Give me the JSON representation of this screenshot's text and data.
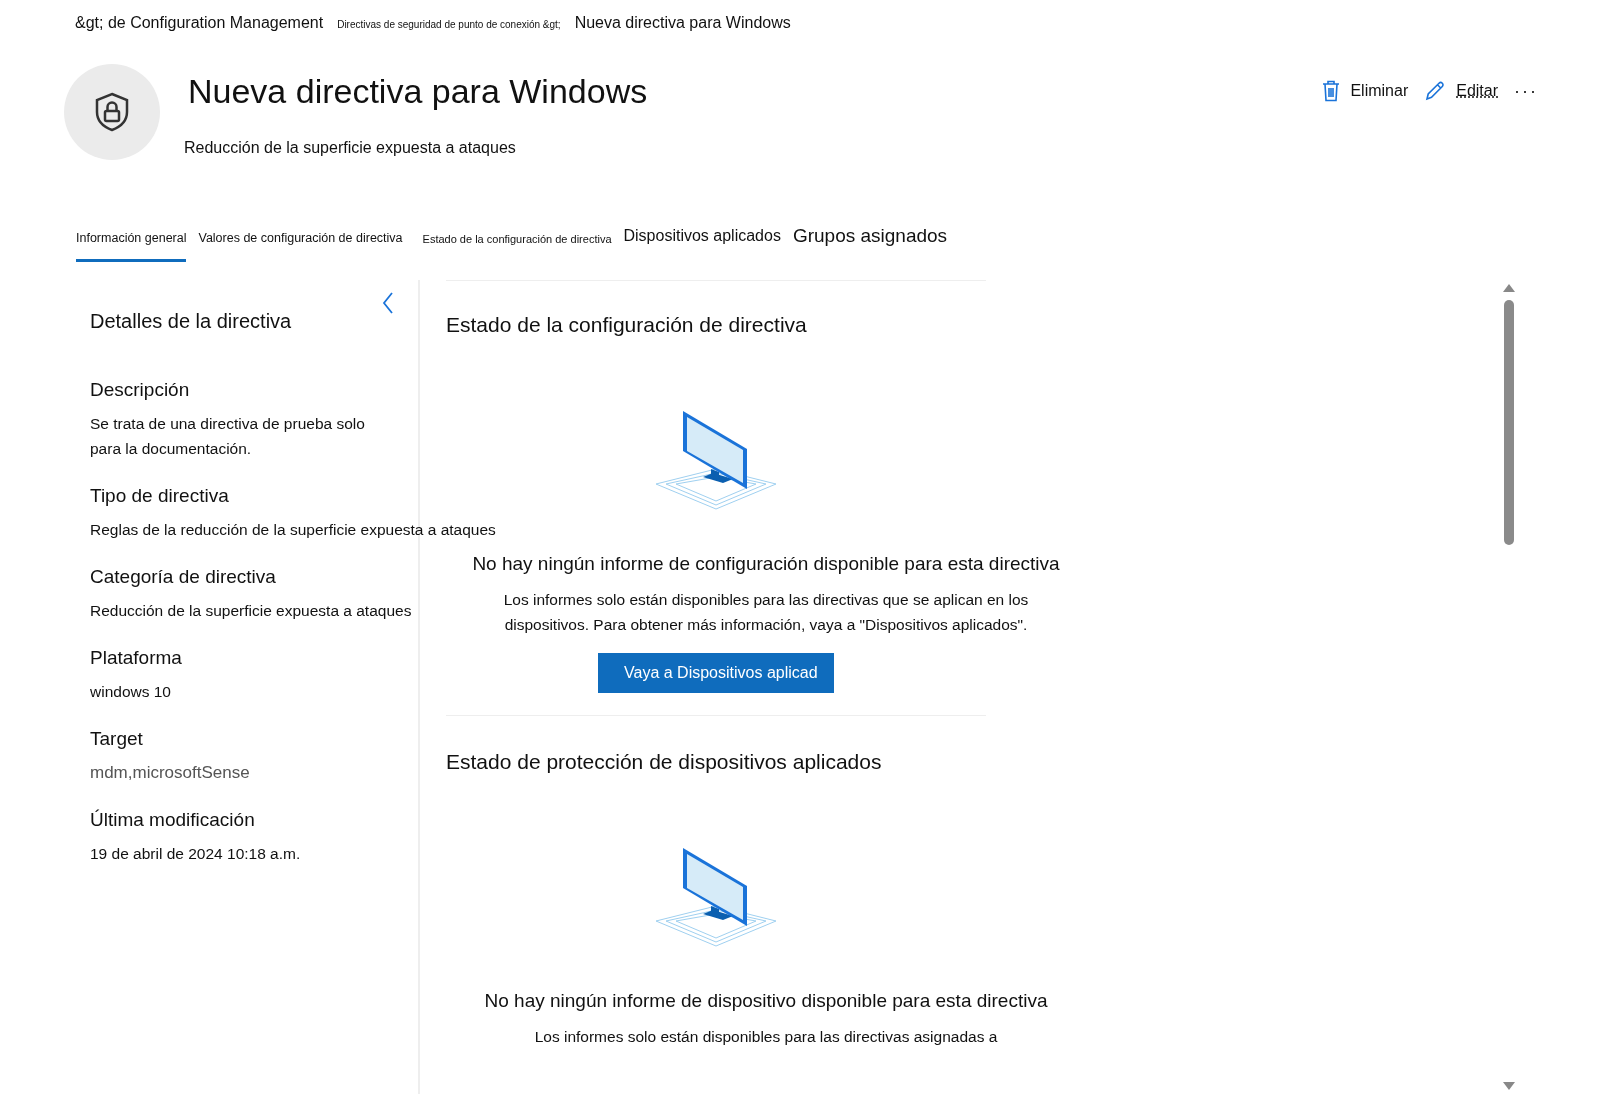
{
  "breadcrumb": [
    "&gt; de Configuration Management",
    "Directivas de seguridad de punto de conexión &gt;",
    "Nueva directiva para Windows"
  ],
  "header": {
    "title": "Nueva directiva para Windows",
    "subtitle": "Reducción de la superficie expuesta a ataques"
  },
  "actions": [
    {
      "kind": "delete",
      "label": "Eliminar"
    },
    {
      "kind": "edit",
      "label": "Editar"
    },
    {
      "kind": "more",
      "label": "···"
    }
  ],
  "tabs": [
    {
      "label": "Información general",
      "selected": true
    },
    {
      "label": "Valores de configuración de directiva",
      "selected": false
    },
    {
      "label": "Estado de la configuración de directiva",
      "selected": false
    },
    {
      "label": "Dispositivos aplicados",
      "selected": false
    },
    {
      "label": "Grupos asignados",
      "selected": false
    }
  ],
  "details": {
    "title": "Detalles de la directiva",
    "fields": [
      {
        "label": "Descripción",
        "value": "Se trata de una directiva de prueba solo para la documentación."
      },
      {
        "label": "Tipo de directiva",
        "value": "Reglas de la reducción de la superficie expuesta a ataques"
      },
      {
        "label": "Categoría de directiva",
        "value": "Reducción de la superficie expuesta a ataques"
      },
      {
        "label": "Plataforma",
        "value": "windows 10"
      },
      {
        "label": "Target",
        "value": "mdm,microsoftSense"
      },
      {
        "label": "Última modificación",
        "value": "19 de abril de 2024 10:18 a.m."
      }
    ]
  },
  "sections": [
    {
      "title": "Estado de la configuración de directiva",
      "message": "No hay ningún informe de configuración disponible para esta directiva",
      "description": "Los informes solo están disponibles para las directivas que se aplican en los dispositivos. Para obtener más información, vaya a \"Dispositivos aplicados\".",
      "button": "Vaya a Dispositivos aplicad"
    },
    {
      "title": "Estado de protección de dispositivos aplicados",
      "message": "No hay ningún informe de dispositivo disponible para esta directiva",
      "description": "Los informes solo están disponibles para las directivas asignadas a"
    }
  ]
}
